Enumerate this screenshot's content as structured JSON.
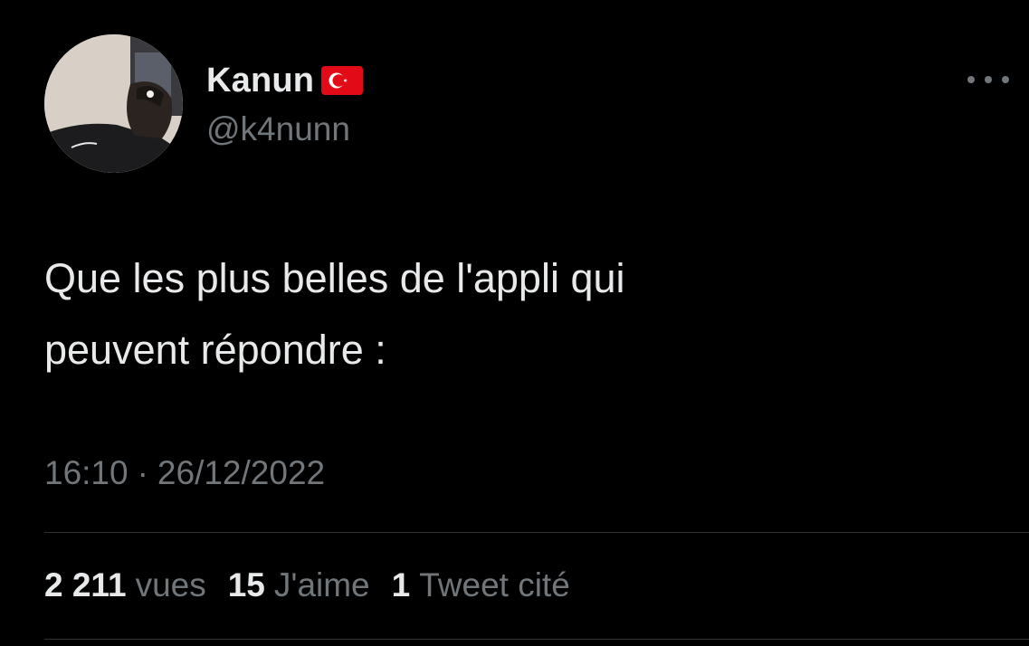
{
  "author": {
    "display_name": "Kanun",
    "handle": "@k4nunn",
    "flag_icon": "turkey-flag-icon",
    "avatar_icon": "profile-photo"
  },
  "menu": {
    "icon": "more-options-icon"
  },
  "tweet": {
    "text_line1": "Que les plus belles de l'appli qui",
    "text_line2": "peuvent répondre :",
    "time": "16:10",
    "separator": "·",
    "date": "26/12/2022"
  },
  "stats": {
    "views_count": "2 211",
    "views_label": "vues",
    "likes_count": "15",
    "likes_label": "J'aime",
    "quotes_count": "1",
    "quotes_label": "Tweet cité"
  },
  "colors": {
    "background": "#000000",
    "primary_text": "#e7e9ea",
    "secondary_text": "#71767b",
    "divider": "#2f3336",
    "flag_red": "#e30a17"
  }
}
